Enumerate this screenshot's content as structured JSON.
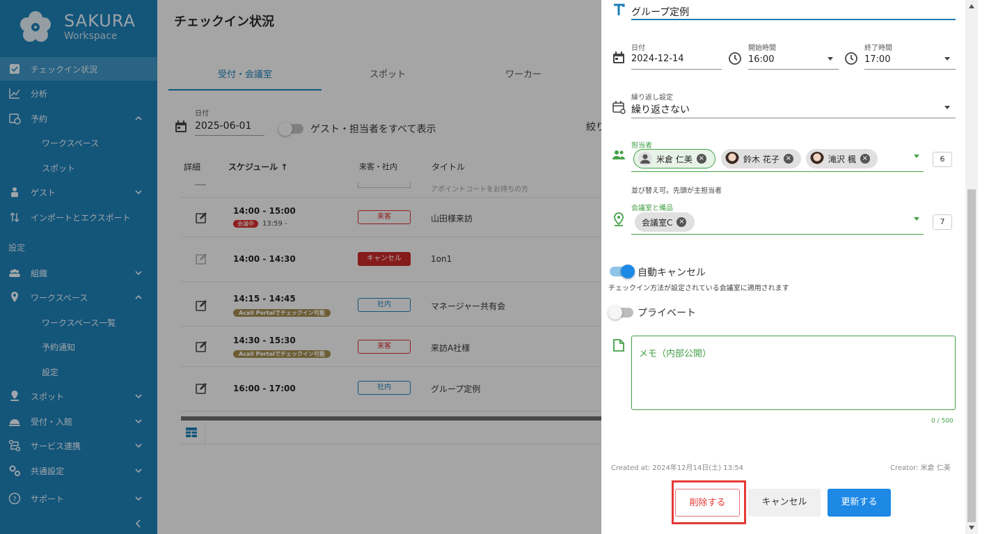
{
  "brand": {
    "name": "SAKURA",
    "sub": "Workspace"
  },
  "sidebar": {
    "items": [
      {
        "label": "チェックイン状況",
        "icon": "checkbox-icon",
        "active": true
      },
      {
        "label": "分析",
        "icon": "chart-line-icon"
      },
      {
        "label": "予約",
        "icon": "calendar-clock-icon",
        "expanded": true
      },
      {
        "label": "ワークスペース",
        "sub": true
      },
      {
        "label": "スポット",
        "sub": true
      },
      {
        "label": "ゲスト",
        "icon": "guest-icon"
      },
      {
        "label": "インポートとエクスポート",
        "icon": "import-export-icon"
      },
      {
        "label": "組織",
        "icon": "people-icon"
      },
      {
        "label": "ワークスペース",
        "icon": "location-pin-icon",
        "expanded": true
      },
      {
        "label": "ワークスペース一覧",
        "sub": true
      },
      {
        "label": "予約通知",
        "sub": true
      },
      {
        "label": "設定",
        "sub": true
      },
      {
        "label": "スポット",
        "icon": "spot-pin-icon"
      },
      {
        "label": "受付・入館",
        "icon": "reception-bell-icon"
      },
      {
        "label": "サービス連携",
        "icon": "integration-icon"
      },
      {
        "label": "共通設定",
        "icon": "gears-icon"
      },
      {
        "label": "サポート",
        "icon": "help-circle-icon"
      }
    ],
    "section_settings": "設定"
  },
  "main": {
    "title": "チェックイン状況",
    "tabs": [
      "受付・会議室",
      "スポット",
      "ワーカー"
    ],
    "date_label": "日付",
    "date_value": "2025-06-01",
    "guest_toggle_label": "ゲスト・担当者をすべて表示",
    "filter_label": "絞り",
    "columns": [
      "詳細",
      "スケジュール",
      "来客・社内",
      "タイトル"
    ],
    "partial_row_title": "アポイントコートをお持ちの方",
    "rows": [
      {
        "time": "14:00 - 15:00",
        "badge": "会議中",
        "badge_time": "13:59 -",
        "type": "来客",
        "title": "山田様来訪"
      },
      {
        "time": "14:00 - 14:30",
        "type": "キャンセル",
        "title": "1on1"
      },
      {
        "time": "14:15 - 14:45",
        "badge": "Acall Portalでチェックイン可能",
        "type": "社内",
        "title": "マネージャー共有会"
      },
      {
        "time": "14:30 - 15:30",
        "badge": "Acall Portalでチェックイン可能",
        "type": "来客",
        "title": "来訪A社様"
      },
      {
        "time": "16:00 - 17:00",
        "type": "社内",
        "title": "グループ定例"
      }
    ]
  },
  "drawer": {
    "title_value": "グループ定例",
    "date_label": "日付",
    "date_value": "2024-12-14",
    "start_label": "開始時間",
    "start_value": "16:00",
    "end_label": "終了時間",
    "end_value": "17:00",
    "repeat_label": "繰り返し設定",
    "repeat_value": "繰り返さない",
    "assignee_label": "担当者",
    "assignees": [
      "米倉 仁美",
      "鈴木 花子",
      "滝沢 楓"
    ],
    "assignee_count": "6",
    "assignee_hint": "並び替え可。先頭が主担当者",
    "room_label": "会議室と備品",
    "rooms": [
      "会議室C"
    ],
    "room_count": "7",
    "auto_cancel_label": "自動キャンセル",
    "auto_cancel_hint": "チェックイン方法が設定されている会議室に適用されます",
    "private_label": "プライベート",
    "memo_placeholder": "メモ（内部公開）",
    "memo_count": "0 / 500",
    "created_at": "Created at: 2024年12月14日(土) 13:54",
    "creator": "Creator: 米倉 仁美",
    "buttons": {
      "delete": "削除する",
      "cancel": "キャンセル",
      "update": "更新する"
    }
  },
  "colors": {
    "sidebar": "#1e7eb4",
    "accent": "#1e88e5",
    "green": "#43a047",
    "danger": "#d32f2f"
  }
}
